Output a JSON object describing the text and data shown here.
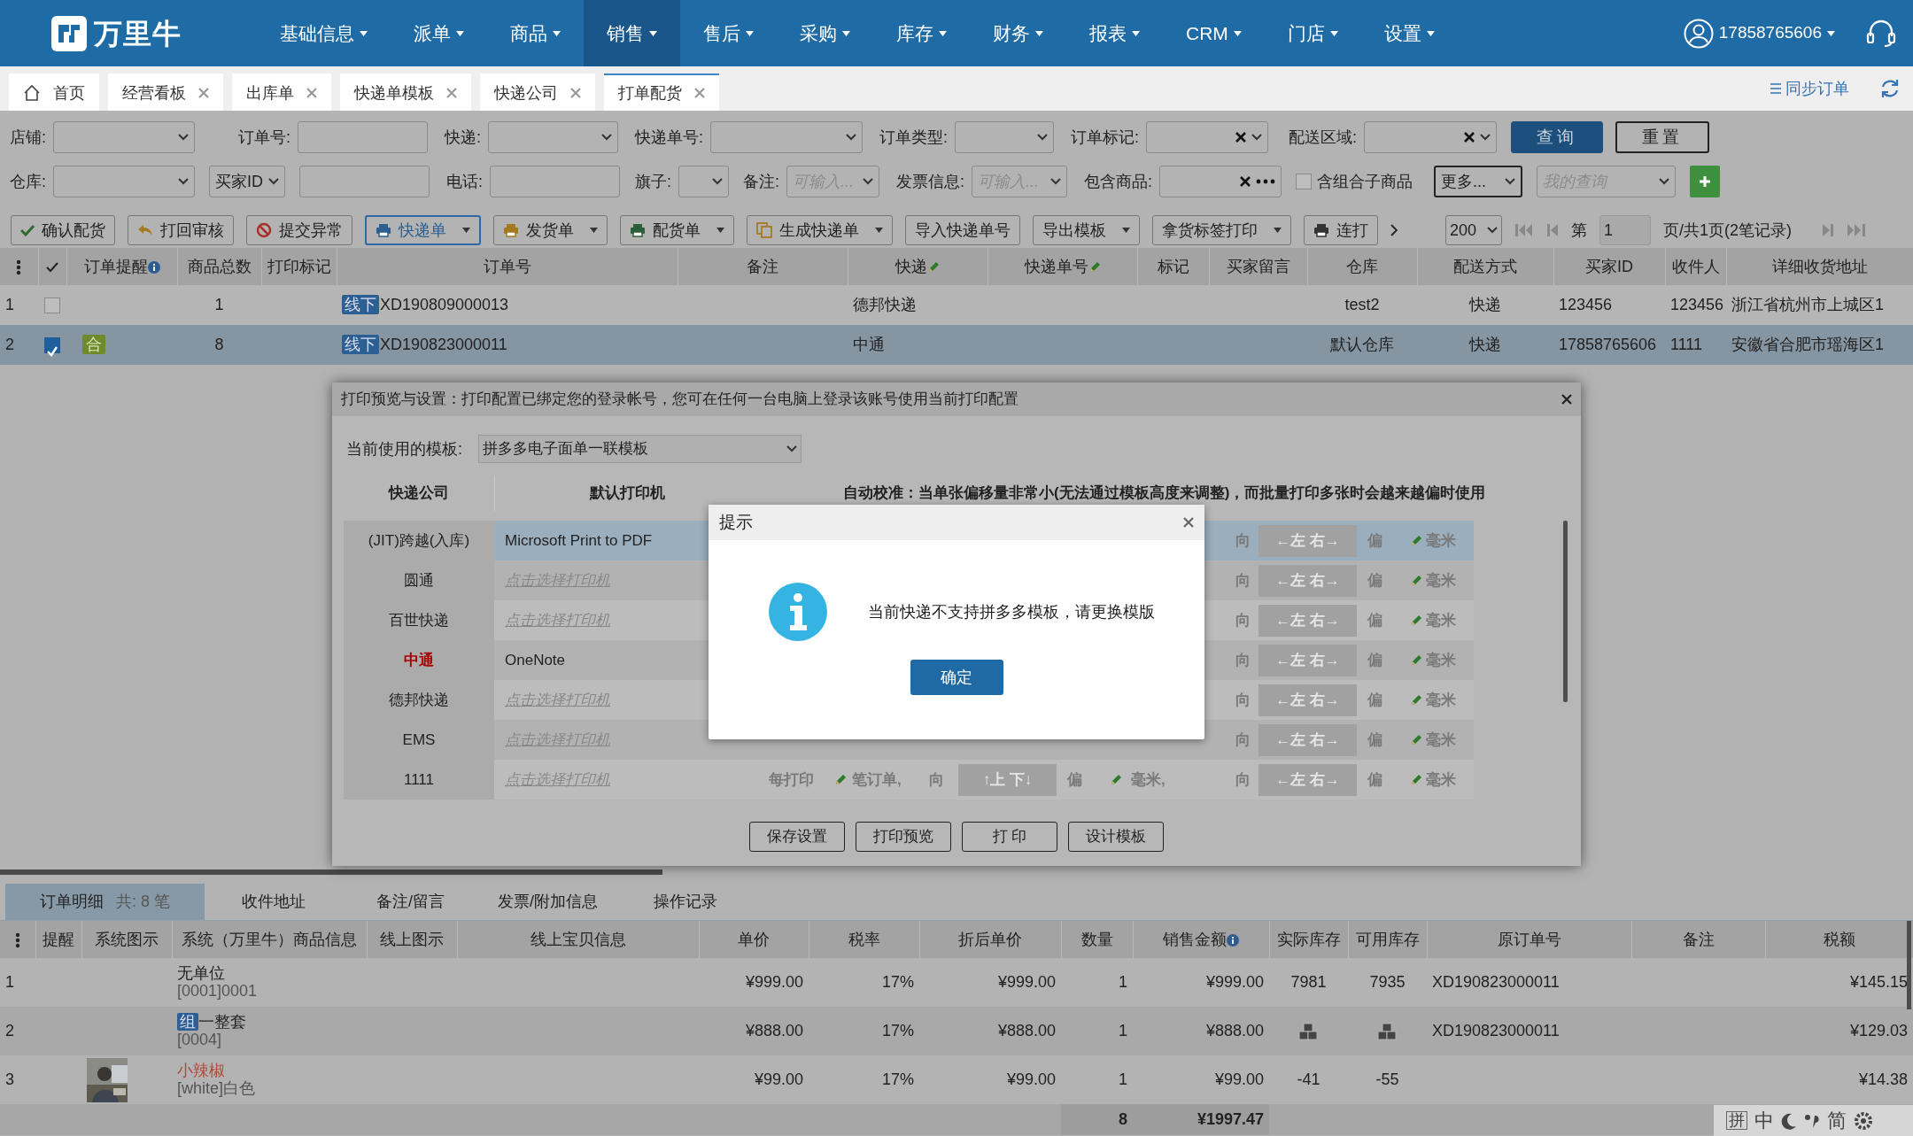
{
  "nav": {
    "brand": "万里牛",
    "menus": [
      {
        "label": "基础信息",
        "selected": false
      },
      {
        "label": "派单",
        "selected": false
      },
      {
        "label": "商品",
        "selected": false
      },
      {
        "label": "销售",
        "selected": true
      },
      {
        "label": "售后",
        "selected": false
      },
      {
        "label": "采购",
        "selected": false
      },
      {
        "label": "库存",
        "selected": false
      },
      {
        "label": "财务",
        "selected": false
      },
      {
        "label": "报表",
        "selected": false
      },
      {
        "label": "CRM",
        "selected": false
      },
      {
        "label": "门店",
        "selected": false
      },
      {
        "label": "设置",
        "selected": false
      }
    ],
    "user": "17858765606"
  },
  "tabs": [
    {
      "label": "首页",
      "kind": "home",
      "selected": false
    },
    {
      "label": "经营看板",
      "kind": "closable",
      "selected": false
    },
    {
      "label": "出库单",
      "kind": "closable",
      "selected": false
    },
    {
      "label": "快递单模板",
      "kind": "closable",
      "selected": false
    },
    {
      "label": "快递公司",
      "kind": "closable",
      "selected": false
    },
    {
      "label": "打单配货",
      "kind": "closable",
      "selected": true
    }
  ],
  "sync_link": "同步订单",
  "filters": [
    [
      {
        "kind": "select",
        "label": "店铺:"
      },
      {
        "kind": "input",
        "label": "订单号:"
      },
      {
        "kind": "select",
        "label": "快递:"
      },
      {
        "kind": "select",
        "label": "快递单号:"
      },
      {
        "kind": "select",
        "label": "订单类型:"
      },
      {
        "kind": "select",
        "label": "订单标记:",
        "clear": true
      },
      {
        "kind": "select",
        "label": "配送区域:",
        "clear": true
      },
      {
        "kind": "button",
        "label": "查询",
        "primary": true
      },
      {
        "kind": "button",
        "label": "重置",
        "primary": false
      }
    ],
    [
      {
        "kind": "select",
        "label": "仓库:"
      },
      {
        "kind": "select",
        "value": "买家ID"
      },
      {
        "kind": "input"
      },
      {
        "kind": "input",
        "label": "电话:"
      },
      {
        "kind": "select",
        "label": "旗子:"
      },
      {
        "kind": "select",
        "label": "备注:",
        "placeholder": "可输入..."
      },
      {
        "kind": "select",
        "label": "发票信息:",
        "placeholder": "可输入..."
      },
      {
        "kind": "input",
        "label": "包含商品:",
        "clear": true,
        "more": true
      },
      {
        "kind": "checkbox",
        "label": "含组合子商品",
        "checked": false
      },
      {
        "kind": "select",
        "value": "更多..."
      },
      {
        "kind": "select",
        "placeholder": "我的查询"
      },
      {
        "kind": "add"
      }
    ]
  ],
  "toolbar": {
    "buttons": [
      {
        "label": "确认配货",
        "kind": "confirm",
        "caret": false,
        "selected": false
      },
      {
        "label": "打回审核",
        "kind": "reject",
        "caret": false,
        "selected": false
      },
      {
        "label": "提交异常",
        "kind": "error",
        "caret": false,
        "selected": false
      },
      {
        "label": "快递单",
        "kind": "print",
        "caret": true,
        "selected": true
      },
      {
        "label": "发货单",
        "kind": "print-gold",
        "caret": true,
        "selected": false
      },
      {
        "label": "配货单",
        "kind": "print-green",
        "caret": true,
        "selected": false
      },
      {
        "label": "生成快递单",
        "kind": "generate",
        "caret": true,
        "selected": false
      },
      {
        "label": "导入快递单号",
        "kind": "plain",
        "caret": false,
        "selected": false
      },
      {
        "label": "导出模板",
        "kind": "plain",
        "caret": true,
        "selected": false
      },
      {
        "label": "拿货标签打印",
        "kind": "plain",
        "caret": true,
        "selected": false
      },
      {
        "label": "连打",
        "kind": "print",
        "caret": false,
        "selected": false
      }
    ],
    "page_size": "200",
    "page_prefix": "第",
    "page": "1",
    "page_suffix": "页/共1页(2笔记录)"
  },
  "orders": {
    "columns": [
      {
        "label": "订单提醒",
        "kind": "hint"
      },
      {
        "label": "商品总数"
      },
      {
        "label": "打印标记"
      },
      {
        "label": "订单号"
      },
      {
        "label": "备注"
      },
      {
        "label": "快递",
        "kind": "editable"
      },
      {
        "label": "快递单号",
        "kind": "editable"
      },
      {
        "label": "标记"
      },
      {
        "label": "买家留言"
      },
      {
        "label": "仓库"
      },
      {
        "label": "配送方式"
      },
      {
        "label": "买家ID"
      },
      {
        "label": "收件人"
      },
      {
        "label": "详细收货地址"
      }
    ],
    "rows": [
      {
        "num": "1",
        "checked": false,
        "selected": false,
        "count": "1",
        "tag": "线下",
        "order_no": "XD190809000013",
        "express": "德邦快递",
        "warehouse": "test2",
        "delivery": "快递",
        "buyer_id": "123456",
        "receiver": "123456",
        "address": "浙江省杭州市上城区1"
      },
      {
        "num": "2",
        "checked": true,
        "selected": true,
        "badge": "合",
        "count": "8",
        "tag": "线下",
        "order_no": "XD190823000011",
        "express": "中通",
        "warehouse": "默认仓库",
        "delivery": "快递",
        "buyer_id": "17858765606",
        "receiver": "1111",
        "address": "安徽省合肥市瑶海区1"
      }
    ]
  },
  "print_dialog": {
    "title": "打印预览与设置：打印配置已绑定您的登录帐号，您可在任何一台电脑上登录该账号使用当前打印配置",
    "template_label": "当前使用的模板:",
    "template": "拼多多电子面单一联模板",
    "headers": [
      "快递公司",
      "默认打印机",
      "自动校准：当单张偏移量非常小(无法通过模板高度来调整)，而批量打印多张时会越来越偏时使用"
    ],
    "rows": [
      {
        "company": "(JIT)跨越(入库)",
        "current": false,
        "selected": true,
        "printer": "Microsoft Print to PDF",
        "assigned": true,
        "side": {
          "dir": "向",
          "left": "←左",
          "right": "右→",
          "offset": "偏",
          "unit": "毫米"
        }
      },
      {
        "company": "圆通",
        "current": false,
        "selected": false,
        "printer": "点击选择打印机",
        "assigned": false,
        "side": {
          "dir": "向",
          "left": "←左",
          "right": "右→",
          "offset": "偏",
          "unit": "毫米"
        }
      },
      {
        "company": "百世快递",
        "current": false,
        "selected": false,
        "printer": "点击选择打印机",
        "assigned": false,
        "side": {
          "dir": "向",
          "left": "←左",
          "right": "右→",
          "offset": "偏",
          "unit": "毫米"
        }
      },
      {
        "company": "中通",
        "current": true,
        "selected": false,
        "printer": "OneNote",
        "assigned": true,
        "side": {
          "dir": "向",
          "left": "←左",
          "right": "右→",
          "offset": "偏",
          "unit": "毫米"
        }
      },
      {
        "company": "德邦快递",
        "current": false,
        "selected": false,
        "printer": "点击选择打印机",
        "assigned": false,
        "side": {
          "dir": "向",
          "left": "←左",
          "right": "右→",
          "offset": "偏",
          "unit": "毫米"
        }
      },
      {
        "company": "EMS",
        "current": false,
        "selected": false,
        "printer": "点击选择打印机",
        "assigned": false,
        "side": {
          "dir": "向",
          "left": "←左",
          "right": "右→",
          "offset": "偏",
          "unit": "毫米"
        }
      },
      {
        "company": "1111",
        "current": false,
        "selected": false,
        "printer": "点击选择打印机",
        "assigned": false,
        "every": {
          "label": "每打印",
          "count": "笔订单,",
          "dir": "向",
          "up": "↑上",
          "down": "下↓",
          "offset": "偏",
          "unit": "毫米,"
        },
        "side": {
          "dir": "向",
          "left": "←左",
          "right": "右→",
          "offset": "偏",
          "unit": "毫米"
        }
      }
    ],
    "buttons": [
      "保存设置",
      "打印预览",
      "打 印",
      "设计模板"
    ]
  },
  "alert": {
    "title": "提示",
    "message": "当前快递不支持拼多多模板，请更换模版",
    "ok": "确定"
  },
  "detail_tabs": [
    {
      "label": "订单明细",
      "count": "共: 8 笔",
      "selected": true
    },
    {
      "label": "收件地址",
      "selected": false
    },
    {
      "label": "备注/留言",
      "selected": false
    },
    {
      "label": "发票/附加信息",
      "selected": false
    },
    {
      "label": "操作记录",
      "selected": false
    }
  ],
  "details": {
    "columns": [
      {
        "label": "提醒"
      },
      {
        "label": "系统图示"
      },
      {
        "label": "系统（万里牛）商品信息"
      },
      {
        "label": "线上图示"
      },
      {
        "label": "线上宝贝信息"
      },
      {
        "label": "单价"
      },
      {
        "label": "税率"
      },
      {
        "label": "折后单价"
      },
      {
        "label": "数量"
      },
      {
        "label": "销售金额",
        "kind": "hint"
      },
      {
        "label": "实际库存"
      },
      {
        "label": "可用库存"
      },
      {
        "label": "原订单号"
      },
      {
        "label": "备注"
      },
      {
        "label": "税额"
      }
    ],
    "rows": [
      {
        "num": "1",
        "name": "无单位",
        "gift": false,
        "kind": "item",
        "sku": "[0001]0001",
        "price": "¥999.00",
        "tax_rate": "17%",
        "net_price": "¥999.00",
        "qty": "1",
        "amount": "¥999.00",
        "stock": "7981",
        "available": "7935",
        "orig_no": "XD190823000011",
        "tax": "¥145.15"
      },
      {
        "num": "2",
        "badge": "组",
        "name": "一整套",
        "gift": false,
        "sku": "[0004]",
        "price": "¥888.00",
        "tax_rate": "17%",
        "net_price": "¥888.00",
        "qty": "1",
        "amount": "¥888.00",
        "kind": "bundle",
        "orig_no": "XD190823000011",
        "tax": "¥129.03"
      },
      {
        "num": "3",
        "name": "小辣椒",
        "gift": true,
        "kind": "item",
        "sku": "[white]白色",
        "price": "¥99.00",
        "tax_rate": "17%",
        "net_price": "¥99.00",
        "qty": "1",
        "amount": "¥99.00",
        "stock": "-41",
        "available": "-55",
        "tax": "¥14.38"
      }
    ],
    "total_qty": "8",
    "total_amount": "¥1997.47"
  },
  "ime_bar": {
    "mode": "拼",
    "lang": "中",
    "script": "简"
  }
}
